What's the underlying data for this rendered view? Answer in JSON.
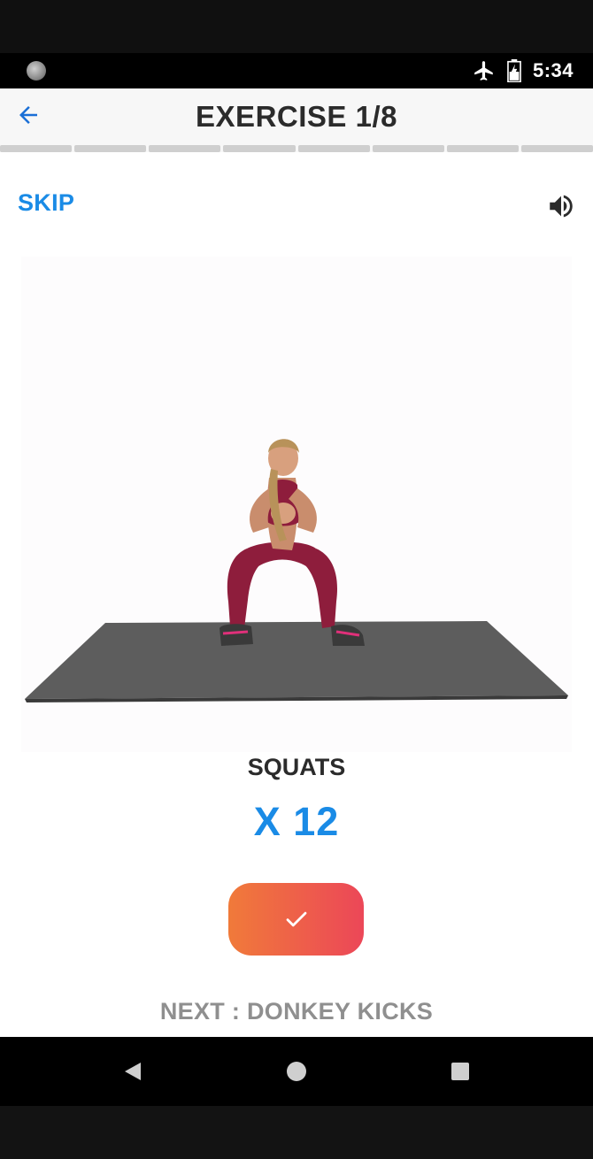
{
  "status_bar": {
    "time": "5:34",
    "icons": [
      "notification-dot-icon",
      "airplane-mode-icon",
      "battery-icon"
    ]
  },
  "header": {
    "title": "EXERCISE 1/8",
    "back_icon": "arrow-left-icon",
    "progress_segments": 8
  },
  "controls": {
    "skip_label": "SKIP",
    "sound_icon": "speaker-icon"
  },
  "exercise": {
    "name": "SQUATS",
    "reps": "X 12",
    "done_icon": "checkmark-icon"
  },
  "next": {
    "label": "NEXT : DONKEY KICKS"
  },
  "nav_bar": {
    "icons": [
      "back-triangle-icon",
      "home-circle-icon",
      "recents-square-icon"
    ]
  },
  "colors": {
    "accent": "#1a8be6",
    "button_gradient_start": "#f07a3a",
    "button_gradient_end": "#ec4758",
    "progress_inactive": "#cfcfcf"
  }
}
